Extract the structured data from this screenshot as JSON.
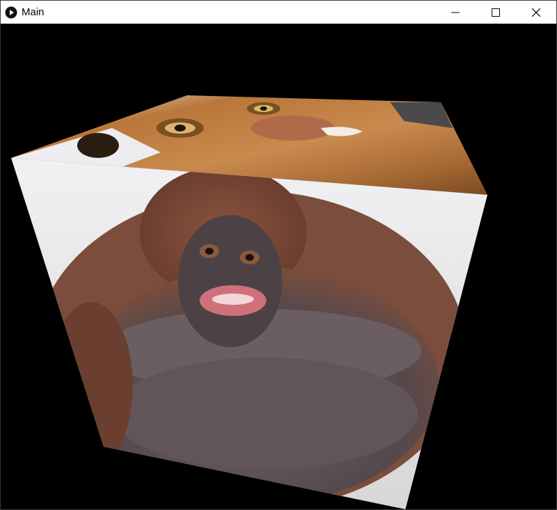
{
  "window": {
    "title": "Main",
    "app_icon": "play-circle-icon",
    "controls": [
      "minimize-icon",
      "maximize-icon",
      "close-icon"
    ]
  },
  "scene": {
    "background_color": "#000000",
    "object": "textured-cube",
    "top_face_image": "monkey face",
    "front_face_image": "orangutan"
  }
}
